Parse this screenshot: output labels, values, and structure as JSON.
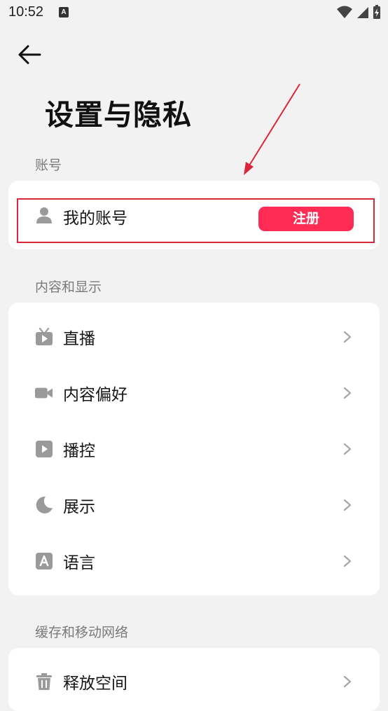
{
  "status_bar": {
    "time": "10:52",
    "notif_letter": "A"
  },
  "page": {
    "title": "设置与隐私"
  },
  "sections": {
    "account": {
      "label": "账号",
      "my_account": "我的账号",
      "register_label": "注册"
    },
    "content": {
      "label": "内容和显示",
      "items": [
        {
          "label": "直播",
          "icon": "tv-icon"
        },
        {
          "label": "内容偏好",
          "icon": "video-camera-icon"
        },
        {
          "label": "播控",
          "icon": "play-icon"
        },
        {
          "label": "展示",
          "icon": "moon-icon"
        },
        {
          "label": "语言",
          "icon": "language-icon"
        }
      ]
    },
    "cache": {
      "label": "缓存和移动网络",
      "items": [
        {
          "label": "释放空间",
          "icon": "trash-icon"
        }
      ]
    }
  },
  "colors": {
    "accent": "#fe2c55",
    "annotation": "#d9263a",
    "background": "#f2f2f2"
  }
}
